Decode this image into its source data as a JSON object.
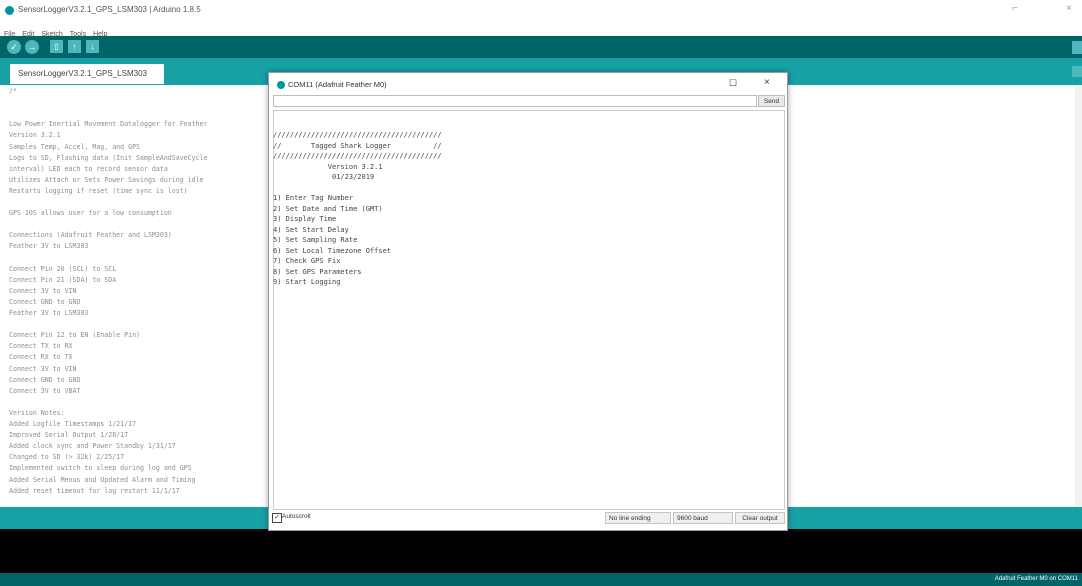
{
  "window": {
    "title": "SensorLoggerV3.2.1_GPS_LSM303 | Arduino 1.8.5",
    "minimize_glyph": "⌐",
    "close_glyph": "×"
  },
  "menu": [
    "File",
    "Edit",
    "Sketch",
    "Tools",
    "Help"
  ],
  "toolbar": {
    "verify_icon": "✓",
    "upload_icon": "→",
    "new_icon": "▯",
    "open_icon": "↑",
    "save_icon": "↓"
  },
  "tab": {
    "label": "SensorLoggerV3.2.1_GPS_LSM303"
  },
  "editor": {
    "lines": [
      "/*",
      "",
      "",
      "Low Power Inertial Movement Datalogger for Feather",
      "Version 3.2.1",
      "Samples Temp, Accel, Mag, and GPS",
      "Logs to SD, Flashing data (Init SampleAndSaveCycle",
      " interval) LED each to record sensor data",
      "Utilizes Attach or Sets Power Savings during idle",
      "Restarts logging if reset (time sync is lost)",
      "",
      "GPS 10S allows user for a low consumption",
      "",
      "Connections (Adafruit Feather and LSM303)",
      "Feather 3V to LSM303",
      "",
      "Connect Pin 20 (SCL) to SCL",
      "Connect Pin 21 (SDA) to SDA",
      "Connect 3V to VIN",
      "Connect GND to GND",
      " Feather 3V to LSM303",
      "",
      "Connect Pin 12 to EN (Enable Pin)",
      "Connect TX to RX",
      "Connect RX to TX",
      "Connect 3V to VIN",
      "Connect GND to GND",
      "Connect 3V to VBAT",
      "",
      "Version Notes:",
      "Added Logfile Timestamps 1/21/17",
      "Improved Serial Output 1/28/17",
      "Added clock sync and Power Standby 1/31/17",
      "Changed to SD (> 32k) 2/25/17",
      " Implemented switch to sleep during log and GPS",
      "Added Serial Menus and Updated Alarm and Timing",
      "Added reset timeout for log restart 11/1/17"
    ]
  },
  "serial_monitor": {
    "title": "COM11 (Adafruit Feather M0)",
    "maximize_glyph": "☐",
    "close_glyph": "×",
    "input_value": "",
    "send_label": "Send",
    "output_lines": [
      "////////////////////////////////////////",
      "//       Tagged Shark Logger          //",
      "////////////////////////////////////////",
      "             Version 3.2.1",
      "              01/23/2019",
      "",
      "1) Enter Tag Number",
      "2) Set Date and Time (GMT)",
      "3) Display Time",
      "4) Set Start Delay",
      "5) Set Sampling Rate",
      "6) Set Local Timezone Offset",
      "7) Check GPS Fix",
      "8) Set GPS Parameters",
      "9) Start Logging"
    ],
    "autoscroll_label": "Autoscroll",
    "autoscroll_checked": "✓",
    "line_ending": "No line ending",
    "baud": "9600 baud",
    "clear_label": "Clear output"
  },
  "status": {
    "board": "Adafruit Feather M0 on COM11"
  },
  "colors": {
    "toolbar": "#006468",
    "tabbar": "#17a1a5",
    "button": "#4db7bb",
    "console": "#000000"
  }
}
